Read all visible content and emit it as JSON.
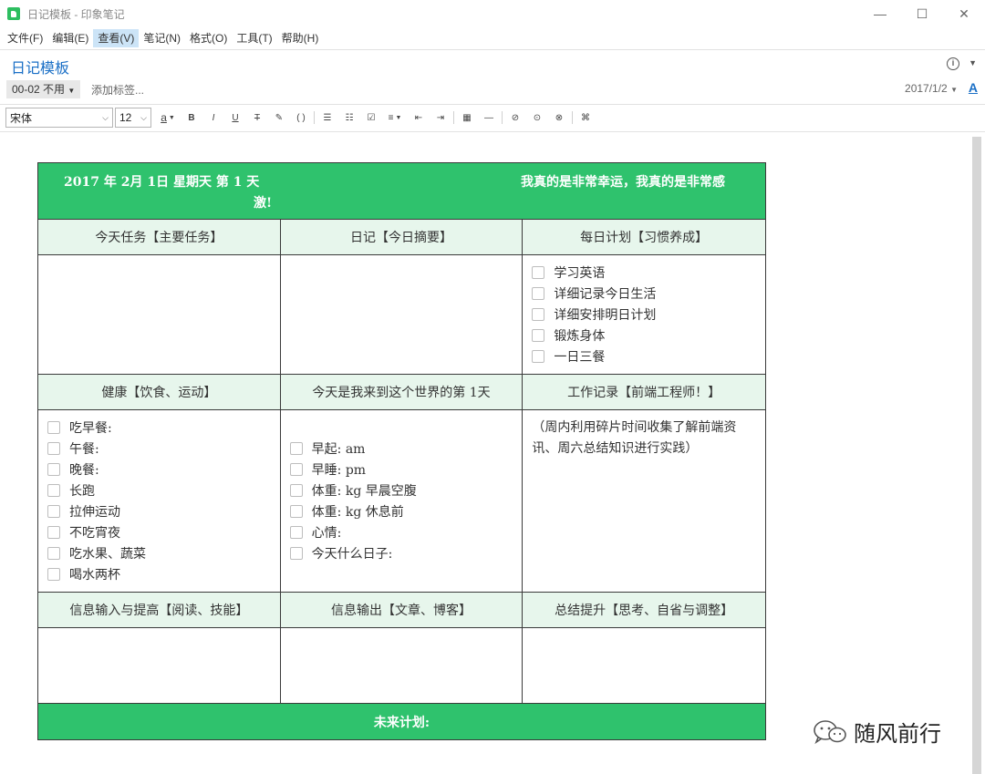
{
  "window": {
    "title": "日记模板 - 印象笔记",
    "controls": {
      "minimize": "—",
      "maximize": "☐",
      "close": "✕"
    }
  },
  "menu": [
    "文件(F)",
    "编辑(E)",
    "查看(V)",
    "笔记(N)",
    "格式(O)",
    "工具(T)",
    "帮助(H)"
  ],
  "note": {
    "title": "日记模板",
    "notebook": "00-02 不用",
    "add_tag": "添加标签...",
    "date": "2017/1/2",
    "font_color_letter": "A",
    "info_letter": "i"
  },
  "toolbar": {
    "font_family": "宋体",
    "font_size": "12",
    "buttons": [
      "a",
      "B",
      "I",
      "U",
      "T",
      "✎",
      "( )",
      "☰",
      "☷",
      "☑",
      "≡",
      "⇤",
      "⇥",
      "▦",
      "—",
      "⊘",
      "⊙",
      "⊗",
      "⌘"
    ]
  },
  "template": {
    "header_left": "2017 年 2月 1日    星期天    第 1 天",
    "header_left_wrap": "激!",
    "header_right": "我真的是非常幸运，我真的是非常感",
    "row1_heads": [
      "今天任务【主要任务】",
      "日记【今日摘要】",
      "每日计划【习惯养成】"
    ],
    "habits": [
      "学习英语",
      "详细记录今日生活",
      "详细安排明日计划",
      "锻炼身体",
      "一日三餐"
    ],
    "row2_heads": [
      "健康【饮食、运动】",
      "今天是我来到这个世界的第 1天",
      "工作记录【前端工程师！】"
    ],
    "health": [
      "吃早餐:",
      "午餐:",
      "晚餐:",
      "长跑",
      "拉伸运动",
      "不吃宵夜",
      "吃水果、蔬菜",
      "喝水两杯"
    ],
    "body": [
      "早起:  am",
      "早睡:  pm",
      "体重:  kg 早晨空腹",
      "体重:  kg 休息前",
      "心情:",
      "今天什么日子:"
    ],
    "work_note": "（周内利用碎片时间收集了解前端资讯、周六总结知识进行实践）",
    "row3_heads": [
      "信息输入与提高【阅读、技能】",
      "信息输出【文章、博客】",
      "总结提升【思考、自省与调整】"
    ],
    "footer": "未来计划:"
  },
  "watermark": "随风前行"
}
